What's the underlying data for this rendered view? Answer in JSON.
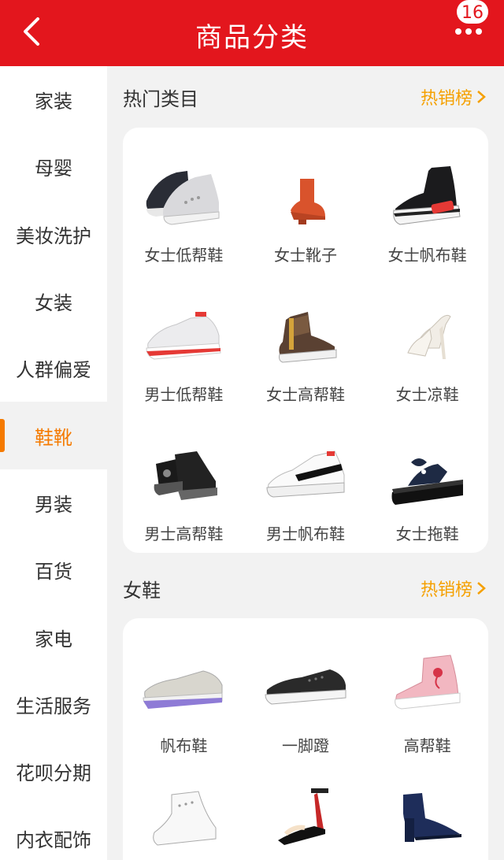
{
  "header": {
    "title": "商品分类",
    "badge_count": "16",
    "back_icon": "chevron-left-icon",
    "more_icon": "more-dots-icon",
    "brand_color": "#e3161d",
    "accent_color": "#f57a00"
  },
  "sidebar": {
    "items": [
      {
        "label": "家装"
      },
      {
        "label": "母婴"
      },
      {
        "label": "美妆洗护"
      },
      {
        "label": "女装"
      },
      {
        "label": "人群偏爱"
      },
      {
        "label": "鞋靴",
        "active": true
      },
      {
        "label": "男装"
      },
      {
        "label": "百货"
      },
      {
        "label": "家电"
      },
      {
        "label": "生活服务"
      },
      {
        "label": "花呗分期"
      },
      {
        "label": "内衣配饰"
      }
    ]
  },
  "sections": [
    {
      "title": "热门类目",
      "hot_link": "热销榜",
      "items": [
        {
          "label": "女士低帮鞋",
          "icon": "wedge-sneaker-icon"
        },
        {
          "label": "女士靴子",
          "icon": "ankle-boot-icon"
        },
        {
          "label": "女士帆布鞋",
          "icon": "high-top-canvas-icon"
        },
        {
          "label": "男士低帮鞋",
          "icon": "running-shoe-icon"
        },
        {
          "label": "女士高帮鞋",
          "icon": "high-top-sneaker-icon"
        },
        {
          "label": "女士凉鞋",
          "icon": "high-heel-icon"
        },
        {
          "label": "男士高帮鞋",
          "icon": "black-high-top-icon"
        },
        {
          "label": "男士帆布鞋",
          "icon": "white-sneaker-icon"
        },
        {
          "label": "女士拖鞋",
          "icon": "platform-slipper-icon"
        }
      ]
    },
    {
      "title": "女鞋",
      "hot_link": "热销榜",
      "items": [
        {
          "label": "帆布鞋",
          "icon": "slip-on-canvas-icon"
        },
        {
          "label": "一脚蹬",
          "icon": "loafer-icon"
        },
        {
          "label": "高帮鞋",
          "icon": "pink-high-top-icon"
        },
        {
          "label": "",
          "icon": "white-wedge-icon"
        },
        {
          "label": "",
          "icon": "strappy-sandal-icon"
        },
        {
          "label": "",
          "icon": "navy-pump-icon"
        }
      ]
    }
  ]
}
